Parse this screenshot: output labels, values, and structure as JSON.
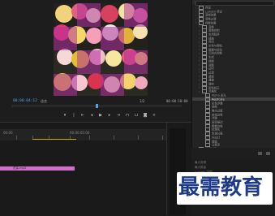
{
  "monitor": {
    "timecode_left": "00:00:04:12",
    "fit_label": "适合",
    "ratio_label": "1/2",
    "timecode_right": "00:00:10:00"
  },
  "effects_panel": {
    "items": [
      {
        "label": "预设",
        "level": 0,
        "selected": false
      },
      {
        "label": "Lumetri 预设",
        "level": 0,
        "selected": false
      },
      {
        "label": "音频效果",
        "level": 0,
        "selected": false
      },
      {
        "label": "音频过渡",
        "level": 0,
        "selected": false
      },
      {
        "label": "视频效果",
        "level": 0,
        "selected": false
      },
      {
        "label": "变换",
        "level": 1,
        "selected": false
      },
      {
        "label": "图像控制",
        "level": 1,
        "selected": false
      },
      {
        "label": "实用程序",
        "level": 1,
        "selected": false
      },
      {
        "label": "扭曲",
        "level": 1,
        "selected": false
      },
      {
        "label": "时间",
        "level": 1,
        "selected": false
      },
      {
        "label": "杂色与颗粒",
        "level": 1,
        "selected": false
      },
      {
        "label": "模糊与锐化",
        "level": 1,
        "selected": false
      },
      {
        "label": "沉浸式视频",
        "level": 1,
        "selected": false
      },
      {
        "label": "生成",
        "level": 1,
        "selected": false
      },
      {
        "label": "视频",
        "level": 1,
        "selected": false
      },
      {
        "label": "调整",
        "level": 1,
        "selected": false
      },
      {
        "label": "过时",
        "level": 1,
        "selected": false
      },
      {
        "label": "过渡",
        "level": 1,
        "selected": false
      },
      {
        "label": "透视",
        "level": 1,
        "selected": false
      },
      {
        "label": "通道",
        "level": 1,
        "selected": false
      },
      {
        "label": "键控",
        "level": 1,
        "selected": false
      },
      {
        "label": "颜色校正",
        "level": 1,
        "selected": false
      },
      {
        "label": "风格化",
        "level": 1,
        "selected": false
      },
      {
        "label": "Alpha 发光",
        "level": 2,
        "selected": false
      },
      {
        "label": "Replicate",
        "level": 2,
        "selected": true
      },
      {
        "label": "彩色浮雕",
        "level": 2,
        "selected": false
      },
      {
        "label": "抽帧",
        "level": 2,
        "selected": false
      },
      {
        "label": "曝光过度",
        "level": 2,
        "selected": false
      },
      {
        "label": "查找边缘",
        "level": 2,
        "selected": false
      },
      {
        "label": "浮雕",
        "level": 2,
        "selected": false
      },
      {
        "label": "画笔描边",
        "level": 2,
        "selected": false
      },
      {
        "label": "粗糙边缘",
        "level": 2,
        "selected": false
      },
      {
        "label": "纹理化",
        "level": 2,
        "selected": false
      },
      {
        "label": "色调分离",
        "level": 2,
        "selected": false
      },
      {
        "label": "闪光灯",
        "level": 2,
        "selected": false
      },
      {
        "label": "阈值",
        "level": 2,
        "selected": false
      },
      {
        "label": "马赛克",
        "level": 2,
        "selected": false
      },
      {
        "label": "视频过渡",
        "level": 0,
        "selected": false
      }
    ]
  },
  "timeline": {
    "start_tc": "00:00",
    "mid_tc": "00:00:05:00",
    "clip_label": "花朵.mp4"
  },
  "side_info": [
    "最大剪辑",
    "最大数量",
    "Lumetri 范围"
  ],
  "watermark": {
    "text": "最需教育"
  },
  "colors": {
    "accent": "#5aa0e8",
    "clip": "#d070c8",
    "watermark": "#1d3a8a"
  }
}
